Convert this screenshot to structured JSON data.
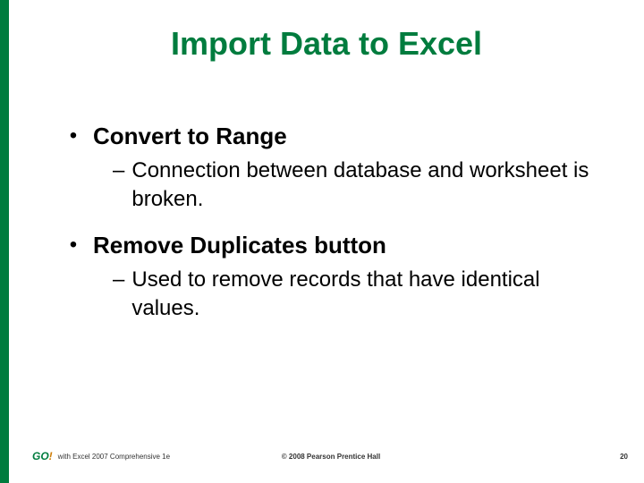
{
  "title": "Import Data to Excel",
  "bullets": [
    {
      "label": "Convert to Range",
      "sub": "Connection between database and worksheet is broken."
    },
    {
      "label": "Remove Duplicates button",
      "sub": "Used to remove records that have identical values."
    }
  ],
  "footer": {
    "logo_text": "GO",
    "logo_exclaim": "!",
    "left": "with Excel 2007 Comprehensive 1e",
    "center": "© 2008 Pearson Prentice Hall",
    "slide_number": "20"
  }
}
